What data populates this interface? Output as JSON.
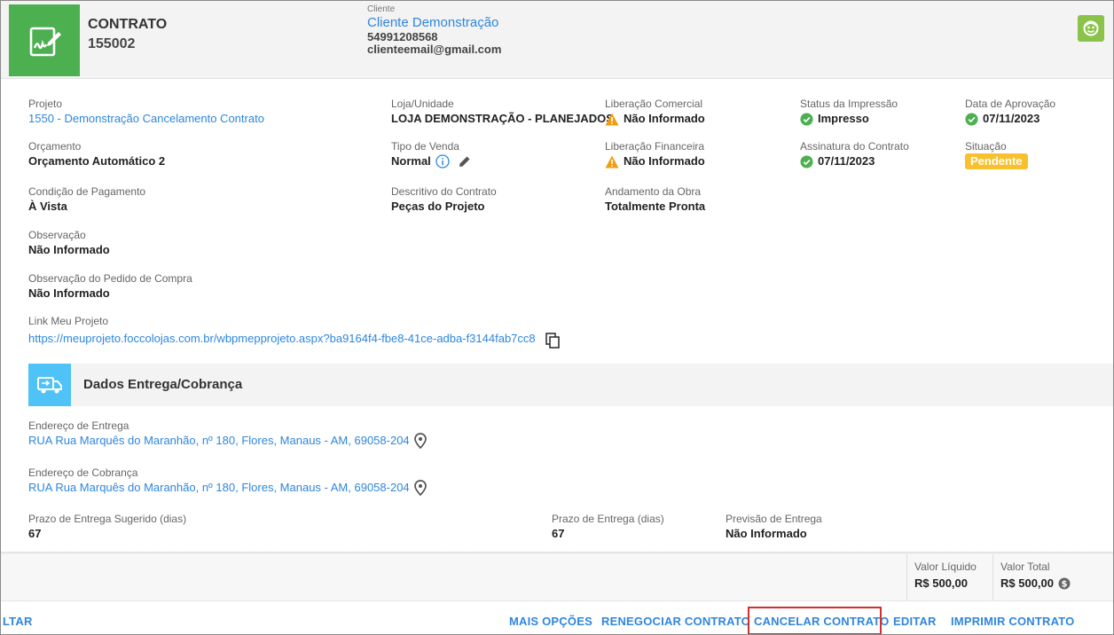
{
  "header": {
    "contract_title": "CONTRATO",
    "contract_number": "155002",
    "client_label": "Cliente",
    "client_name": "Cliente Demonstração",
    "client_phone": "54991208568",
    "client_email": "clienteemail@gmail.com",
    "icons": {
      "contract": "contract-sign-icon",
      "face": "face-icon"
    }
  },
  "fields": {
    "projeto": {
      "label": "Projeto",
      "value": "1550 - Demonstração Cancelamento Contrato"
    },
    "loja": {
      "label": "Loja/Unidade",
      "value": "LOJA DEMONSTRAÇÃO - PLANEJADOS"
    },
    "lib_comercial": {
      "label": "Liberação Comercial",
      "value": "Não Informado"
    },
    "status_impressao": {
      "label": "Status da Impressão",
      "value": "Impresso"
    },
    "data_aprovacao": {
      "label": "Data de Aprovação",
      "value": "07/11/2023"
    },
    "orcamento": {
      "label": "Orçamento",
      "value": "Orçamento Automático 2"
    },
    "tipo_venda": {
      "label": "Tipo de Venda",
      "value": "Normal"
    },
    "lib_financeira": {
      "label": "Liberação Financeira",
      "value": "Não Informado"
    },
    "assinatura": {
      "label": "Assinatura do Contrato",
      "value": "07/11/2023"
    },
    "situacao": {
      "label": "Situação",
      "value": "Pendente"
    },
    "condicao": {
      "label": "Condição de Pagamento",
      "value": "À Vista"
    },
    "descritivo": {
      "label": "Descritivo do Contrato",
      "value": "Peças do Projeto"
    },
    "andamento": {
      "label": "Andamento da Obra",
      "value": "Totalmente Pronta"
    },
    "observacao": {
      "label": "Observação",
      "value": "Não Informado"
    },
    "obs_pedido": {
      "label": "Observação do Pedido de Compra",
      "value": "Não Informado"
    },
    "link_projeto": {
      "label": "Link Meu Projeto",
      "value": "https://meuprojeto.foccolojas.com.br/wbpmepprojeto.aspx?ba9164f4-fbe8-41ce-adba-f3144fab7cc8"
    }
  },
  "delivery": {
    "section_title": "Dados Entrega/Cobrança",
    "endereco_entrega": {
      "label": "Endereço de Entrega",
      "value": "RUA Rua Marquês do Maranhão, nº 180, Flores, Manaus - AM, 69058-204"
    },
    "endereco_cobranca": {
      "label": "Endereço de Cobrança",
      "value": "RUA Rua Marquês do Maranhão, nº 180, Flores, Manaus - AM, 69058-204"
    },
    "prazo_sugerido": {
      "label": "Prazo de Entrega Sugerido (dias)",
      "value": "67"
    },
    "prazo": {
      "label": "Prazo de Entrega (dias)",
      "value": "67"
    },
    "previsao": {
      "label": "Previsão de Entrega",
      "value": "Não Informado"
    }
  },
  "totals": {
    "liquido": {
      "label": "Valor Líquido",
      "value": "R$ 500,00"
    },
    "total": {
      "label": "Valor Total",
      "value": "R$ 500,00"
    }
  },
  "footer": {
    "voltar": "LTAR",
    "mais_opcoes": "MAIS OPÇÕES",
    "renegociar": "RENEGOCIAR CONTRATO",
    "cancelar": "CANCELAR CONTRATO",
    "editar": "EDITAR",
    "imprimir": "IMPRIMIR CONTRATO"
  },
  "colors": {
    "accent_blue": "#2e86de",
    "green": "#4caf50",
    "warning": "#f39c12",
    "pending": "#f9c02d",
    "highlight": "#d32f2f"
  }
}
